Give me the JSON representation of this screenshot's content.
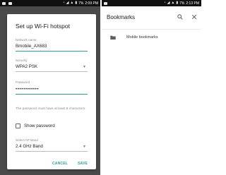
{
  "left_phone": {
    "statusbar": {
      "time": "2:09 PM",
      "battery": "7%",
      "icons": [
        "notification-square-icon",
        "notification-square-icon",
        "clock-icon",
        "wifi-icon",
        "signal-icon",
        "battery-icon"
      ]
    },
    "dialog": {
      "title": "Set up Wi-Fi hotspot",
      "network_name_label": "Network name",
      "network_name_value": "Bmobile_AX683",
      "security_label": "Security",
      "security_value": "WPA2 PSK",
      "password_label": "Password",
      "password_value": "••••••••••••",
      "password_note": "The password must have at least 8 characters.",
      "show_password_label": "Show password",
      "show_password_checked": false,
      "ap_band_label": "Select AP Band",
      "ap_band_value": "2.4 GHz Band",
      "cancel_label": "CANCEL",
      "save_label": "SAVE"
    },
    "accent_color": "#2e9c9a"
  },
  "right_phone": {
    "statusbar": {
      "time": "2:13 PM",
      "battery": "7%",
      "icons": [
        "notification-square-icon",
        "clock-icon",
        "wifi-icon",
        "signal-icon",
        "battery-icon"
      ]
    },
    "appbar": {
      "title": "Bookmarks",
      "search_icon": "search-icon",
      "close_icon": "close-icon"
    },
    "folders": [
      {
        "label": "Mobile bookmarks",
        "icon": "folder-icon"
      }
    ]
  }
}
